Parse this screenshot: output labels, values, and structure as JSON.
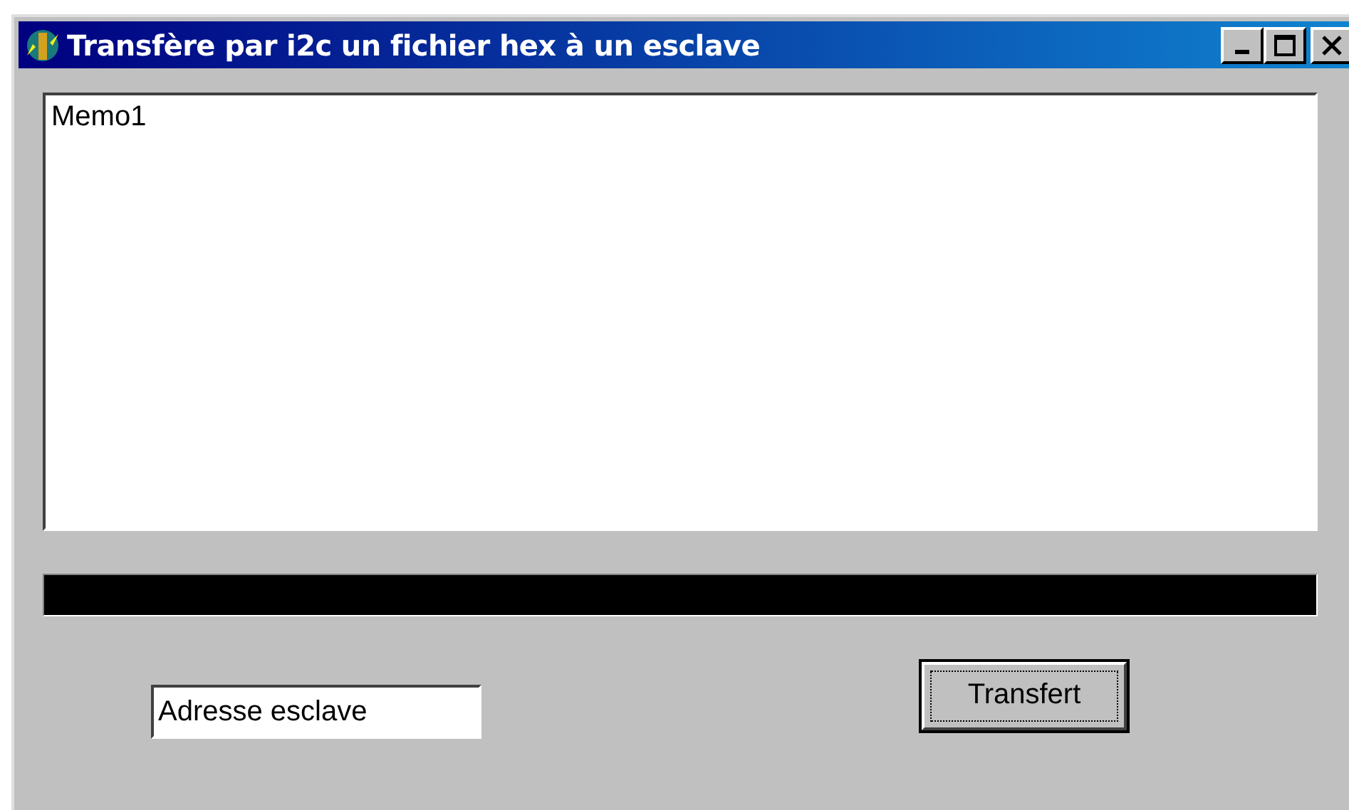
{
  "window": {
    "title": "Transfère par i2c un fichier hex à un esclave"
  },
  "memo": {
    "value": "Memo1"
  },
  "progress": {
    "level": 1
  },
  "address_field": {
    "value": "Adresse esclave"
  },
  "buttons": [
    {
      "label": "Transfert",
      "focused": true
    }
  ]
}
